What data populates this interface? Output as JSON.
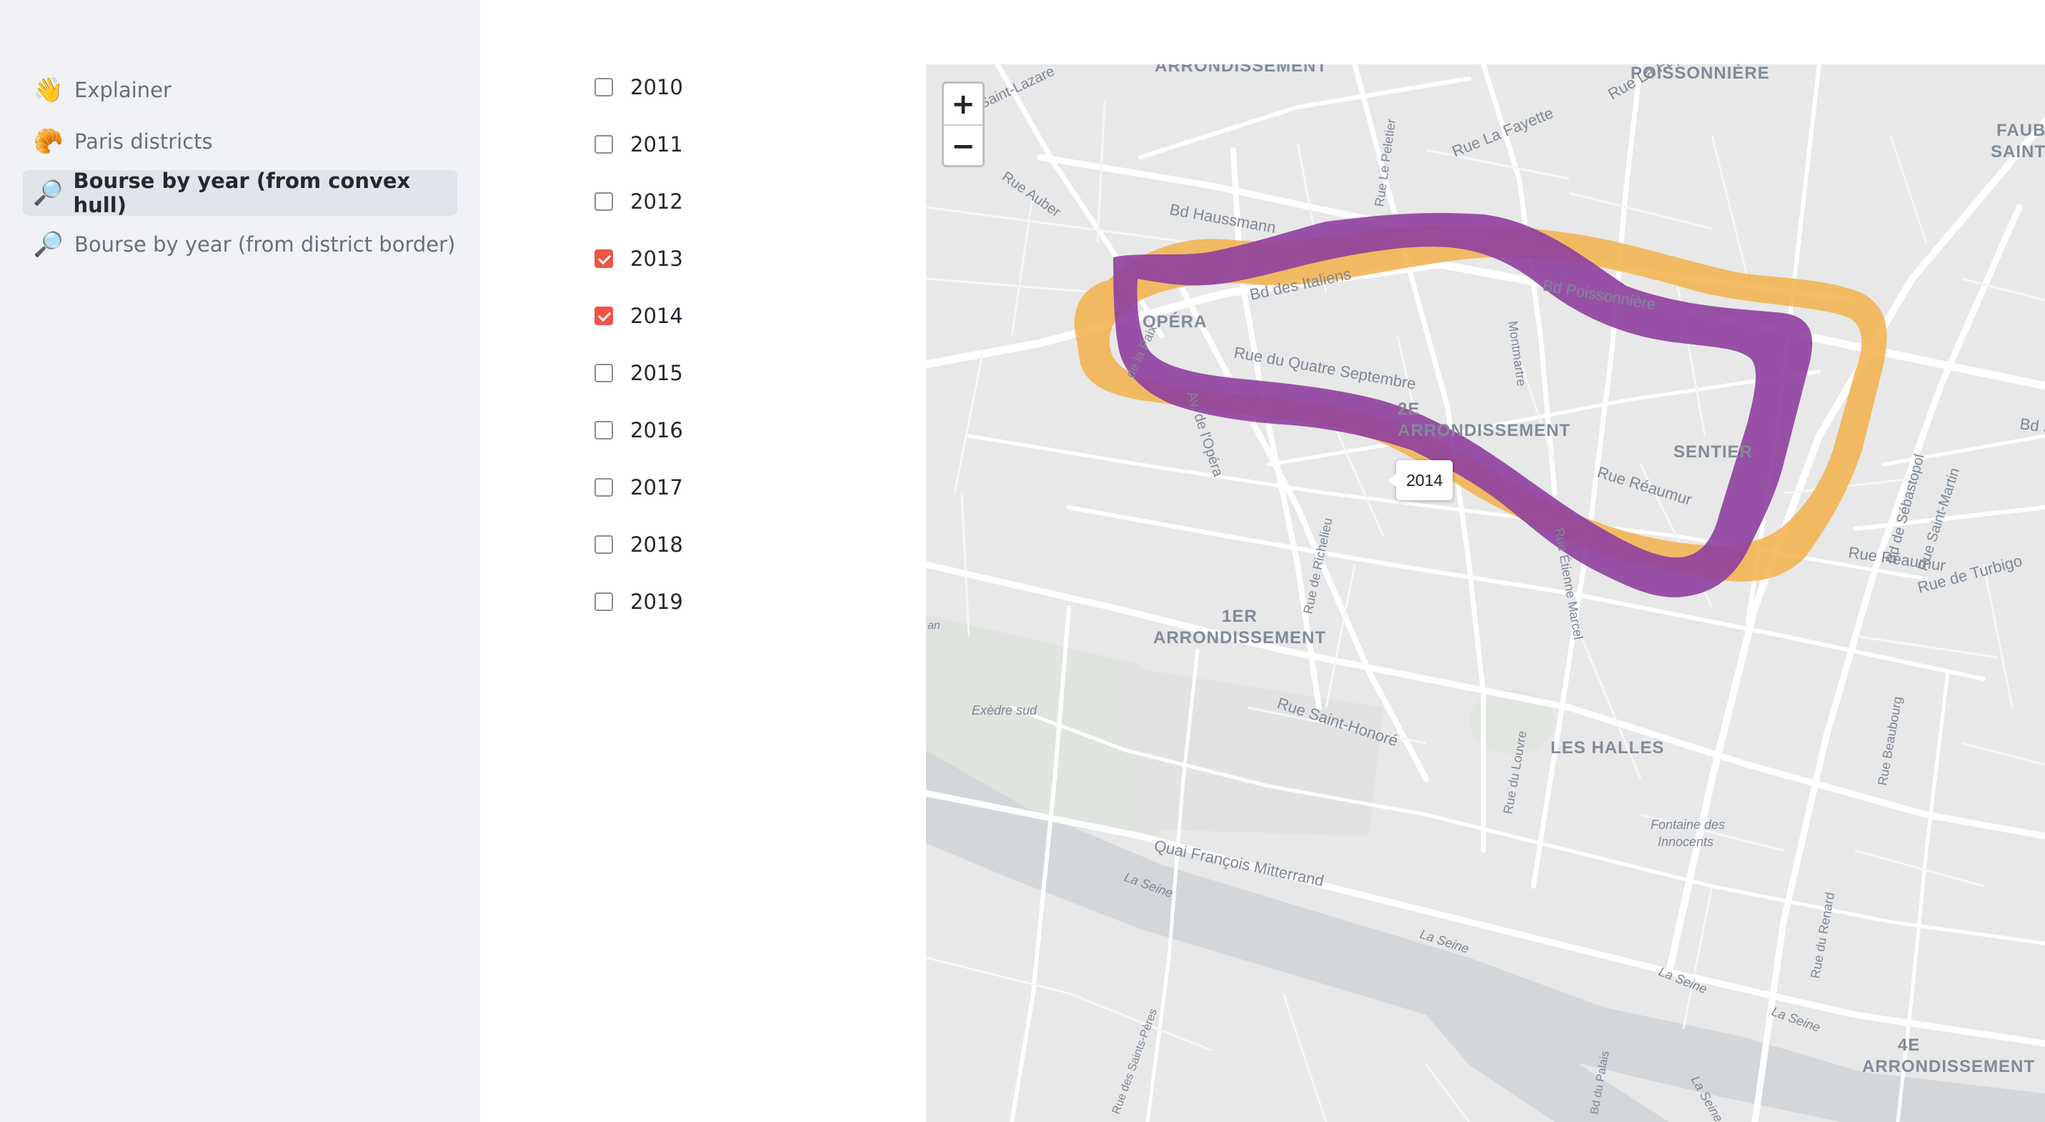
{
  "sidebar": {
    "items": [
      {
        "emoji": "👋",
        "label": "Explainer",
        "active": false
      },
      {
        "emoji": "🥐",
        "label": "Paris districts",
        "active": false
      },
      {
        "emoji": "🔎",
        "label": "Bourse by year (from convex hull)",
        "active": true
      },
      {
        "emoji": "🔎",
        "label": "Bourse by year (from district border)",
        "active": false
      }
    ]
  },
  "years": [
    {
      "label": "2010",
      "checked": false
    },
    {
      "label": "2011",
      "checked": false
    },
    {
      "label": "2012",
      "checked": false
    },
    {
      "label": "2013",
      "checked": true
    },
    {
      "label": "2014",
      "checked": true
    },
    {
      "label": "2015",
      "checked": false
    },
    {
      "label": "2016",
      "checked": false
    },
    {
      "label": "2017",
      "checked": false
    },
    {
      "label": "2018",
      "checked": false
    },
    {
      "label": "2019",
      "checked": false
    }
  ],
  "map": {
    "zoom_in": "+",
    "zoom_out": "−",
    "tooltip": "2014",
    "layers": [
      {
        "year": "2013",
        "color": "#f2b04a"
      },
      {
        "year": "2014",
        "color": "#8e3f9e"
      }
    ],
    "labels": {
      "arr_top": "ARRONDISSEMENT",
      "poissonniere": "POISSONNIÈRE",
      "faubourg": "FAUBO",
      "saint_m": "SAINT-M",
      "opera": "OPÉRA",
      "arr2_a": "2E",
      "arr2_b": "ARRONDISSEMENT",
      "sentier": "SENTIER",
      "arr1_a": "1ER",
      "arr1_b": "ARRONDISSEMENT",
      "les_halles": "LES HALLES",
      "arr4_a": "4E",
      "arr4_b": "ARRONDISSEMENT",
      "st_lazare": "Rue Saint-Lazare",
      "lafayette1": "Rue La Fayette",
      "lafayette2": "Rue La Fayette",
      "le_peletier": "Rue Le Peletier",
      "auber": "Rue Auber",
      "haussmann": "Bd Haussmann",
      "italiens": "Bd des Italiens",
      "poissonniere_bd": "Bd Poissonnière",
      "montmartre": "Montmartre",
      "quatre_sept": "Rue du Quatre Septembre",
      "paix": "de la Paix",
      "av_opera": "Av. de l'Opéra",
      "reaumur": "Rue Réaumur",
      "reaumur2": "Rue Réaumur",
      "turbigo": "Rue de Turbigo",
      "sebastopol": "Bd de Sébastopol",
      "st_martin": "Rue Saint-Martin",
      "bd_s": "Bd S",
      "richelieu": "Rue de Richelieu",
      "louvre_rue": "Rue du Louvre",
      "st_honore": "Rue Saint-Honoré",
      "exedre": "Exèdre sud",
      "fontaine1": "Fontaine des",
      "fontaine2": "Innocents",
      "beaubourg": "Rue Beaubourg",
      "renard": "Rue du Renard",
      "quai": "Quai François Mitterrand",
      "seine1": "La Seine",
      "seine2": "La Seine",
      "seine3": "La Seine",
      "seine4": "La Seine",
      "seine5": "La Seine",
      "st_peres": "Rue des Saints-Pères",
      "palais": "Bd du Palais",
      "montorgueil": "Rue Étienne Marcel",
      "an": "an"
    }
  }
}
